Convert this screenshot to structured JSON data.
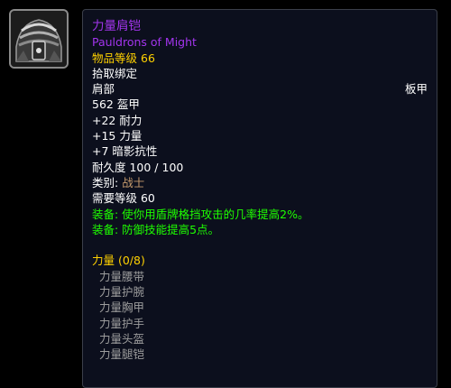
{
  "item": {
    "name_cn": "力量肩铠",
    "name_en": "Pauldrons of Might",
    "item_level_label": "物品等级",
    "item_level": "66",
    "binding": "拾取绑定",
    "slot": "肩部",
    "armor_type": "板甲",
    "armor": "562 盔甲",
    "stats": [
      "+22 耐力",
      "+15 力量",
      "+7 暗影抗性"
    ],
    "durability": "耐久度 100 / 100",
    "class_label": "类别:",
    "class_value": "战士",
    "required_level": "需要等级 60",
    "equip_effects": [
      "装备: 使你用盾牌格挡攻击的几率提高2%。",
      "装备: 防御技能提高5点。"
    ],
    "set": {
      "title": "力量 (0/8)",
      "items": [
        "力量腰带",
        "力量护腕",
        "力量胸甲",
        "力量护手",
        "力量头盔",
        "力量腿铠"
      ]
    }
  },
  "icon": {
    "name": "pauldrons-icon"
  },
  "colors": {
    "epic": "#a335ee",
    "gold": "#ffd100",
    "equip_green": "#1eff00",
    "class_tan": "#c69b6d",
    "set_grey": "#9d9d9d"
  }
}
